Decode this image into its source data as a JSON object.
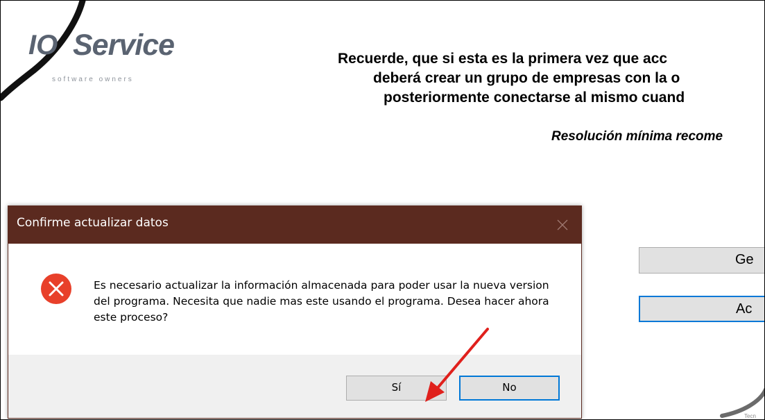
{
  "logo": {
    "prefix": "IO",
    "wordmark": "Service",
    "tagline": "software owners",
    "icon": "logo-swoosh"
  },
  "background": {
    "message_lines": [
      "Recuerde, que si esta es la primera vez que acc",
      "deberá crear un grupo de empresas con la o",
      "posteriormente conectarse al mismo cuand"
    ],
    "resolution_note": "Resolución mínima recome",
    "buttons": [
      {
        "label": "Ge"
      },
      {
        "label": "Ac"
      }
    ],
    "corner_text": "Tecn"
  },
  "dialog": {
    "title": "Confirme actualizar datos",
    "close_icon": "close-icon",
    "status_icon": "error-icon",
    "message": "Es necesario actualizar la información almacenada para poder usar la nueva version del programa. Necesita que nadie mas este usando el programa. Desea hacer ahora este proceso?",
    "yes_label": "Sí",
    "no_label": "No"
  },
  "annotation": {
    "icon": "red-arrow",
    "color": "#e0201c"
  },
  "colors": {
    "titlebar": "#5b2a1f",
    "error": "#e8402a",
    "focus_border": "#0078d7"
  }
}
